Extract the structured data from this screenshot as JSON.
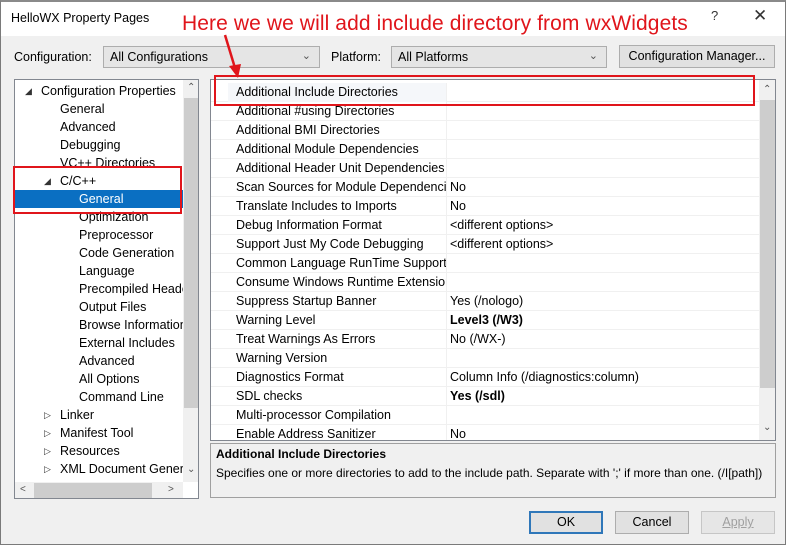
{
  "window": {
    "title": "HelloWX Property Pages",
    "help_label": "?",
    "close_label": "✕"
  },
  "annotation": {
    "text": "Here we we will add include directory from wxWidgets",
    "color": "#e0151b"
  },
  "toolbar": {
    "configuration_label": "Configuration:",
    "configuration_value": "All Configurations",
    "platform_label": "Platform:",
    "platform_value": "All Platforms",
    "config_manager_label": "Configuration Manager..."
  },
  "tree": {
    "items": [
      {
        "label": "Configuration Properties",
        "expanded": true
      },
      {
        "label": "General"
      },
      {
        "label": "Advanced"
      },
      {
        "label": "Debugging"
      },
      {
        "label": "VC++ Directories"
      },
      {
        "label": "C/C++",
        "expanded": true
      },
      {
        "label": "General",
        "selected": true
      },
      {
        "label": "Optimization"
      },
      {
        "label": "Preprocessor"
      },
      {
        "label": "Code Generation"
      },
      {
        "label": "Language"
      },
      {
        "label": "Precompiled Heade"
      },
      {
        "label": "Output Files"
      },
      {
        "label": "Browse Information"
      },
      {
        "label": "External Includes"
      },
      {
        "label": "Advanced"
      },
      {
        "label": "All Options"
      },
      {
        "label": "Command Line"
      },
      {
        "label": "Linker",
        "expanded": false
      },
      {
        "label": "Manifest Tool",
        "expanded": false
      },
      {
        "label": "Resources",
        "expanded": false
      },
      {
        "label": "XML Document Genera",
        "expanded": false
      }
    ],
    "selection_color": "#0a6fc2"
  },
  "grid": {
    "rows": [
      {
        "name": "Additional Include Directories",
        "value": ""
      },
      {
        "name": "Additional #using Directories",
        "value": ""
      },
      {
        "name": "Additional BMI Directories",
        "value": ""
      },
      {
        "name": "Additional Module Dependencies",
        "value": ""
      },
      {
        "name": "Additional Header Unit Dependencies",
        "value": ""
      },
      {
        "name": "Scan Sources for Module Dependencies",
        "value": "No"
      },
      {
        "name": "Translate Includes to Imports",
        "value": "No"
      },
      {
        "name": "Debug Information Format",
        "value": "<different options>"
      },
      {
        "name": "Support Just My Code Debugging",
        "value": "<different options>"
      },
      {
        "name": "Common Language RunTime Support",
        "value": ""
      },
      {
        "name": "Consume Windows Runtime Extension",
        "value": ""
      },
      {
        "name": "Suppress Startup Banner",
        "value": "Yes (/nologo)"
      },
      {
        "name": "Warning Level",
        "value": "Level3 (/W3)",
        "bold": true
      },
      {
        "name": "Treat Warnings As Errors",
        "value": "No (/WX-)"
      },
      {
        "name": "Warning Version",
        "value": ""
      },
      {
        "name": "Diagnostics Format",
        "value": "Column Info (/diagnostics:column)"
      },
      {
        "name": "SDL checks",
        "value": "Yes (/sdl)",
        "bold": true
      },
      {
        "name": "Multi-processor Compilation",
        "value": ""
      },
      {
        "name": "Enable Address Sanitizer",
        "value": "No"
      }
    ]
  },
  "description": {
    "title": "Additional Include Directories",
    "text": "Specifies one or more directories to add to the include path. Separate with ';' if more than one. (/I[path])"
  },
  "buttons": {
    "ok": "OK",
    "cancel": "Cancel",
    "apply": "Apply"
  }
}
